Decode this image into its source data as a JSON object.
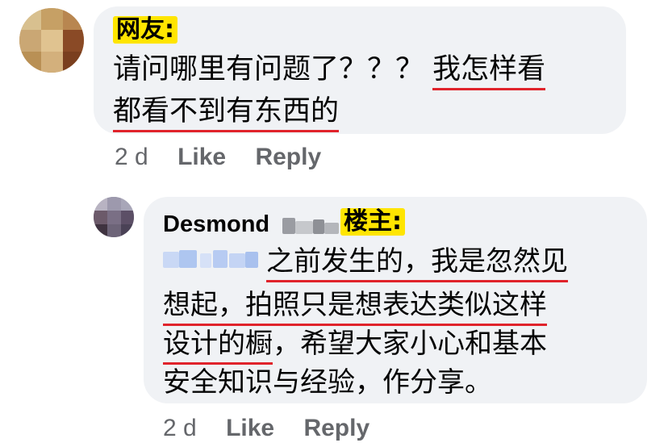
{
  "comment1": {
    "tag": "网友:",
    "lines": [
      "请问哪里有问题了？？？",
      "我怎样看",
      "都看不到有东西的"
    ],
    "time": "2 d",
    "like": "Like",
    "reply": "Reply"
  },
  "comment2": {
    "author": "Desmond",
    "tag": "楼主:",
    "line1": "之前发生的，我是忽然见",
    "line2": "想起，拍照只是想表达类似这样",
    "line3a": "设计的橱",
    "line3b": "，希望大家小心和基本",
    "line4": "安全知识与经验，作分享。",
    "time": "2 d",
    "like": "Like",
    "reply": "Reply"
  },
  "colors": {
    "bubble": "#f0f2f5",
    "meta": "#65676b",
    "underline": "#e0232b",
    "tag": "#ffe500"
  }
}
